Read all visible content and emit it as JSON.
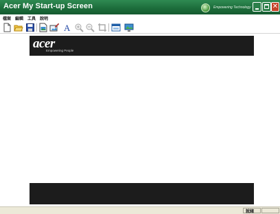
{
  "window": {
    "title": "Acer My Start-up Screen",
    "brand_text": "Empowering Technology"
  },
  "menu": {
    "items": [
      "檔案",
      "編輯",
      "工具",
      "說明"
    ]
  },
  "toolbar": {
    "buttons": [
      {
        "name": "new-file-icon"
      },
      {
        "name": "open-folder-icon"
      },
      {
        "name": "save-icon"
      },
      {
        "name": "import-image-icon"
      },
      {
        "name": "edit-image-icon"
      },
      {
        "name": "text-tool-icon",
        "glyph": "A"
      },
      {
        "name": "zoom-in-icon"
      },
      {
        "name": "zoom-out-icon"
      },
      {
        "name": "crop-icon"
      },
      {
        "name": "preview-icon"
      },
      {
        "name": "apply-screen-icon"
      }
    ]
  },
  "banner": {
    "logo_text": "acer",
    "tagline": "Empowering People"
  },
  "status": {
    "text": "就緒"
  },
  "colors": {
    "titlebar": "#1d6e3c",
    "banner": "#1c1c1c",
    "close_button": "#c5432a"
  }
}
